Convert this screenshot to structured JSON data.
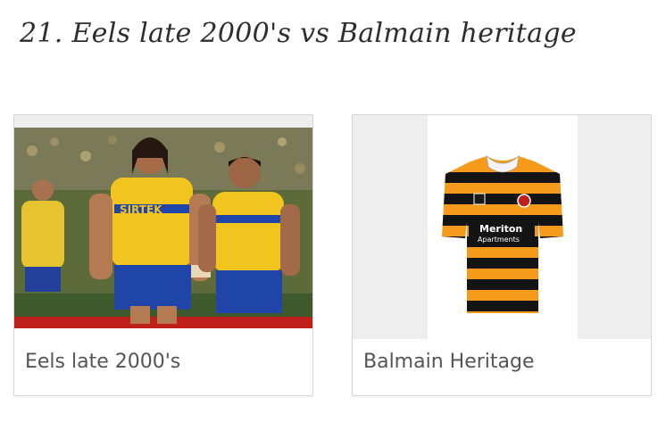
{
  "heading": "21. Eels late 2000's vs Balmain heritage",
  "cards": [
    {
      "caption": "Eels late 2000's",
      "image": "eels-players-photo",
      "sponsor_text": "SIRTEK"
    },
    {
      "caption": "Balmain Heritage",
      "image": "balmain-jersey",
      "sponsor_text": "Meriton Apartments"
    }
  ],
  "colors": {
    "eels_yellow": "#f2c420",
    "eels_blue": "#1f45a8",
    "balmain_orange": "#f59a1a",
    "balmain_black": "#141414"
  }
}
